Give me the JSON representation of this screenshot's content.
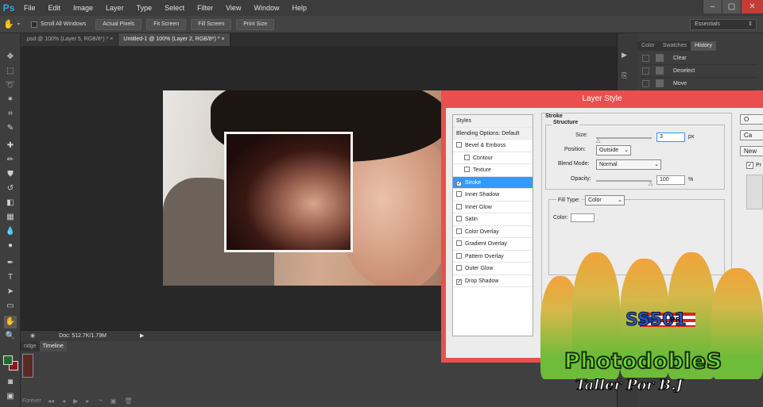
{
  "app": {
    "logo": "Ps"
  },
  "menu": [
    "File",
    "Edit",
    "Image",
    "Layer",
    "Type",
    "Select",
    "Filter",
    "View",
    "Window",
    "Help"
  ],
  "window_buttons": [
    "–",
    "▢",
    "✕"
  ],
  "options_bar": {
    "scroll_all_label": "Scroll All Windows",
    "buttons": [
      "Actual Pixels",
      "Fit Screen",
      "Fill Screen",
      "Print Size"
    ],
    "workspace": "Essentials"
  },
  "doc_tabs": [
    {
      "label": ".psd @ 100% (Layer 5, RGB/8*) *",
      "active": false
    },
    {
      "label": "Untitled-1 @ 100% (Layer 2, RGB/8*) *",
      "active": true
    }
  ],
  "status": {
    "doc": "Doc: 512.7K/1.79M"
  },
  "bottom_tabs": [
    "ridge",
    "Timeline"
  ],
  "timeline": {
    "mode": "Forever"
  },
  "panels": {
    "tabs": [
      "Color",
      "Swatches",
      "History"
    ],
    "active_tab": "History",
    "history": [
      "Clear",
      "Deselect",
      "Move"
    ]
  },
  "dialog": {
    "title": "Layer Style",
    "styles": [
      {
        "label": "Styles",
        "header": true
      },
      {
        "label": "Blending Options: Default",
        "header": true
      },
      {
        "label": "Bevel & Emboss",
        "checked": false
      },
      {
        "label": "Contour",
        "checked": false,
        "sub": true
      },
      {
        "label": "Texture",
        "checked": false,
        "sub": true
      },
      {
        "label": "Stroke",
        "checked": true,
        "selected": true
      },
      {
        "label": "Inner Shadow",
        "checked": false
      },
      {
        "label": "Inner Glow",
        "checked": false
      },
      {
        "label": "Satin",
        "checked": false
      },
      {
        "label": "Color Overlay",
        "checked": false
      },
      {
        "label": "Gradient Overlay",
        "checked": false
      },
      {
        "label": "Pattern Overlay",
        "checked": false
      },
      {
        "label": "Outer Glow",
        "checked": false
      },
      {
        "label": "Drop Shadow",
        "checked": true
      }
    ],
    "stroke": {
      "group_label": "Stroke",
      "structure_label": "Structure",
      "size_label": "Size:",
      "size_value": "3",
      "size_unit": "px",
      "position_label": "Position:",
      "position_value": "Outside",
      "blend_label": "Blend Mode:",
      "blend_value": "Normal",
      "opacity_label": "Opacity:",
      "opacity_value": "100",
      "opacity_unit": "%",
      "fill_type_label": "Fill Type:",
      "fill_type_value": "Color",
      "color_label": "Color:",
      "stroke_color": "#ffffff"
    },
    "buttons": [
      "O",
      "Ca",
      "New"
    ],
    "preview_label": "Pr"
  },
  "watermark": {
    "logo_text": "SS501",
    "tag": "PR",
    "title": "PhotodobleS",
    "subtitle": "Taller Por B.J"
  },
  "colors": {
    "foreground": "#1f6b2a",
    "background": "#8b1a1a",
    "accent": "#29a8e0",
    "dialog_frame": "#eb4f4d"
  }
}
